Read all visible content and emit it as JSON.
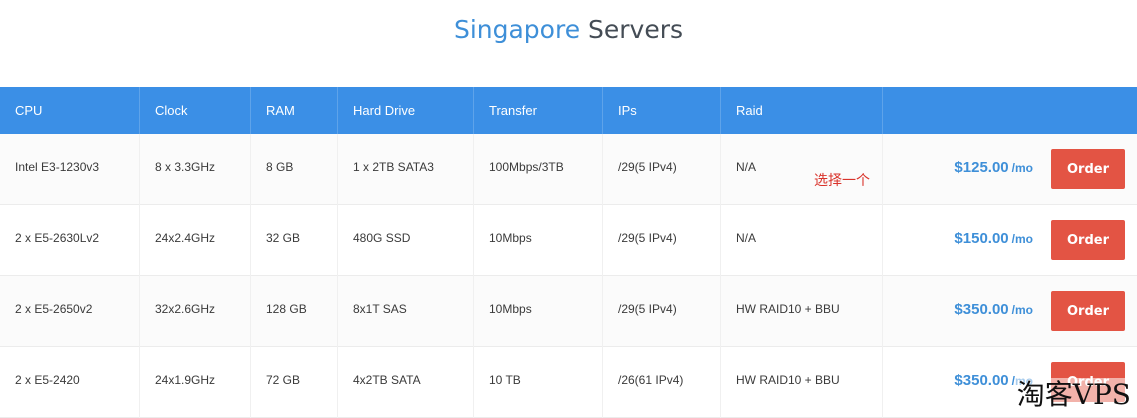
{
  "page": {
    "title_accent": "Singapore",
    "title_rest": "Servers"
  },
  "table": {
    "headers": [
      "CPU",
      "Clock",
      "RAM",
      "Hard Drive",
      "Transfer",
      "IPs",
      "Raid",
      ""
    ],
    "rows": [
      {
        "cpu": "Intel E3-1230v3",
        "clock": "8 x 3.3GHz",
        "ram": "8 GB",
        "drive": "1 x 2TB SATA3",
        "transfer": "100Mbps/3TB",
        "ips": "/29(5 IPv4)",
        "raid": "N/A",
        "price": "$125.00",
        "per": "/mo",
        "order": "Order"
      },
      {
        "cpu": "2 x E5-2630Lv2",
        "clock": "24x2.4GHz",
        "ram": "32 GB",
        "drive": "480G SSD",
        "transfer": "10Mbps",
        "ips": "/29(5 IPv4)",
        "raid": "N/A",
        "price": "$150.00",
        "per": "/mo",
        "order": "Order"
      },
      {
        "cpu": "2 x E5-2650v2",
        "clock": "32x2.6GHz",
        "ram": "128 GB",
        "drive": "8x1T SAS",
        "transfer": "10Mbps",
        "ips": "/29(5 IPv4)",
        "raid": "HW RAID10 + BBU",
        "price": "$350.00",
        "per": "/mo",
        "order": "Order"
      },
      {
        "cpu": "2 x E5-2420",
        "clock": "24x1.9GHz",
        "ram": "72 GB",
        "drive": "4x2TB SATA",
        "transfer": "10 TB",
        "ips": "/26(61 IPv4)",
        "raid": "HW RAID10 + BBU",
        "price": "$350.00",
        "per": "/mo",
        "order": "Order"
      }
    ]
  },
  "annotation": "选择一个",
  "watermark": "淘客VPS",
  "colors": {
    "header_bg": "#3b8fe6",
    "accent": "#3e8fd8",
    "order_button": "#e35444",
    "annotation": "#d9332b"
  }
}
